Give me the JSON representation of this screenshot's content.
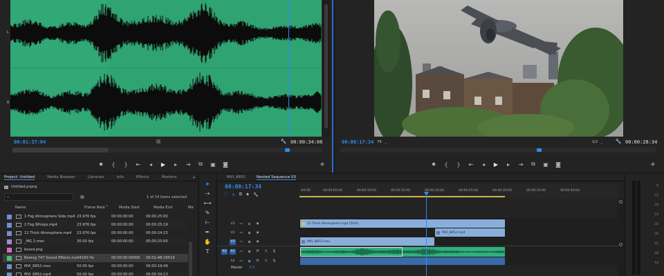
{
  "source_monitor": {
    "timecode_current": "00:01:37:04",
    "timecode_duration": "00:00:34:08",
    "channel_labels": [
      "L",
      "R"
    ]
  },
  "program_monitor": {
    "timecode_current": "00:00:17:34",
    "fit_label": "Fit",
    "resolution": "1/2",
    "timecode_duration": "00:00:28:34"
  },
  "project": {
    "tabs": [
      "Project: Untitled",
      "Media Browser",
      "Libraries",
      "Info",
      "Effects",
      "Markers"
    ],
    "project_file": "Untitled.prproj",
    "selection_status": "1 of 14 items selected",
    "columns": [
      "Name",
      "Frame Rate",
      "Media Start",
      "Media End",
      "Me"
    ],
    "items": [
      {
        "name": "1 Fog Atmosphere Side.mp4",
        "rate": "23.976 fps",
        "start": "00:00:00:00",
        "end": "00:00:25:00",
        "color": "#6f8fd0"
      },
      {
        "name": "2 Fog Whisps.mp4",
        "rate": "23.976 fps",
        "start": "00:00:00:00",
        "end": "00:00:25:19",
        "color": "#6f8fd0"
      },
      {
        "name": "12 Thick Atmosphere.mp4",
        "rate": "23.976 fps",
        "start": "00:00:00:00",
        "end": "00:00:24:23",
        "color": "#6f8fd0"
      },
      {
        "name": "_MG 2.mov",
        "rate": "30.00 fps",
        "start": "00:00:00:00",
        "end": "00:00:25:00",
        "color": "#a58ad6"
      },
      {
        "name": "board.png",
        "rate": "",
        "start": "",
        "end": "",
        "color": "#d66bc8"
      },
      {
        "name": "Boeing 747 Sound Effects.mp",
        "rate": "44100 Hz",
        "start": "00:00:00:00000",
        "end": "00:01:48:29519",
        "color": "#46c07a"
      },
      {
        "name": "MVI_8852.mov",
        "rate": "50.00 fps",
        "start": "00:00:00:00",
        "end": "00:00:19:49",
        "color": "#6f8fd0"
      },
      {
        "name": "MVI_8852.mp4",
        "rate": "50.00 fps",
        "start": "00:00:00:00",
        "end": "00:00:34:13",
        "color": "#6f8fd0"
      }
    ]
  },
  "timeline": {
    "tabs": [
      "MVI_8852",
      "Nested Sequence 03"
    ],
    "timecode": "00:00:17:34",
    "ruler_labels": [
      ":00:00",
      "00:00:05:00",
      "00:00:10:00",
      "00:00:15:00",
      "00:00:20:00",
      "00:00:25:00",
      "00:00:30:00",
      "00:00:35:00",
      "00:00:40:00"
    ],
    "tracks": [
      {
        "src": "",
        "name": "V3"
      },
      {
        "src": "",
        "name": "V2"
      },
      {
        "src": "",
        "name": "V1"
      },
      {
        "src": "A1",
        "name": "A1"
      },
      {
        "src": "",
        "name": "A2"
      }
    ],
    "master_label": "Master",
    "master_value": "0.0",
    "clips": {
      "v3": "12 Thick Atmosphere.mp4 [50%]",
      "v2": "MVI_8852.mp4",
      "v1": "MVI_8852.mov"
    }
  },
  "audio_meter": {
    "ticks": [
      "-6",
      "-12",
      "-18",
      "-24",
      "-30",
      "-36",
      "-42",
      "-48",
      "-54"
    ]
  },
  "colors": {
    "accent_blue": "#2d8ceb",
    "waveform_green": "#2fa372",
    "clip_blue": "#8aaedc",
    "clip_green": "#31b07f"
  }
}
